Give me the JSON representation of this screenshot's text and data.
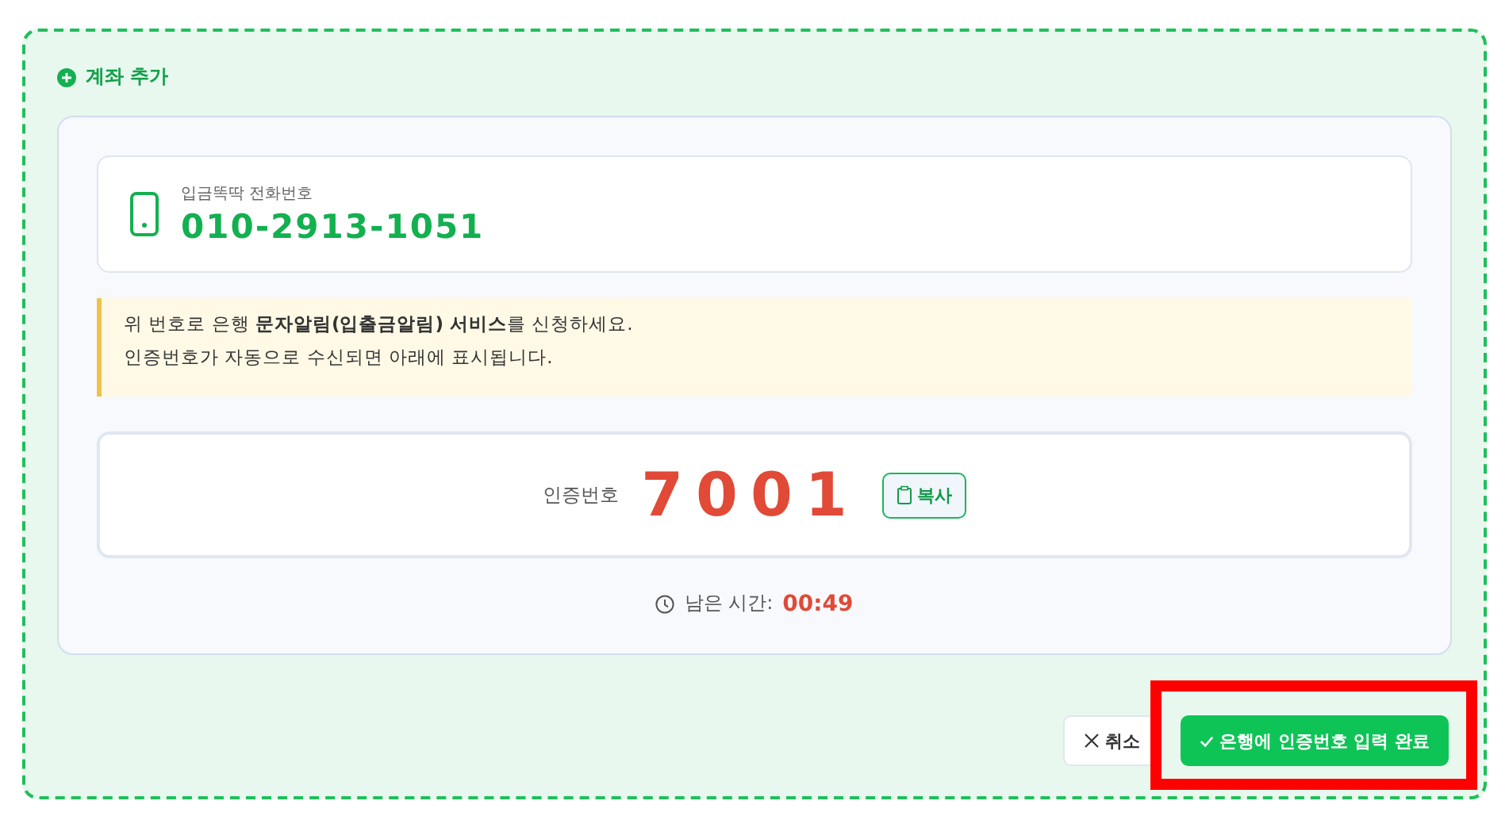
{
  "section_title": "계좌 추가",
  "phone": {
    "label": "입금똑딱 전화번호",
    "number": "010-2913-1051"
  },
  "notice": [
    "위 번호로 은행 **문자알림(입출금알림) 서비스**를 신청하세요.",
    "인증번호가 자동으로 수신되면 아래에 표시됩니다."
  ],
  "code": {
    "label": "인증번호",
    "value": "7001",
    "copy_button": "복사"
  },
  "timer": {
    "label": "남은 시간:",
    "value": "00:49"
  },
  "buttons": [
    {
      "kind": "cancel",
      "label": "취소",
      "highlighted": false
    },
    {
      "kind": "confirm",
      "label": "은행에 인증번호 입력 완료",
      "highlighted": true
    }
  ]
}
